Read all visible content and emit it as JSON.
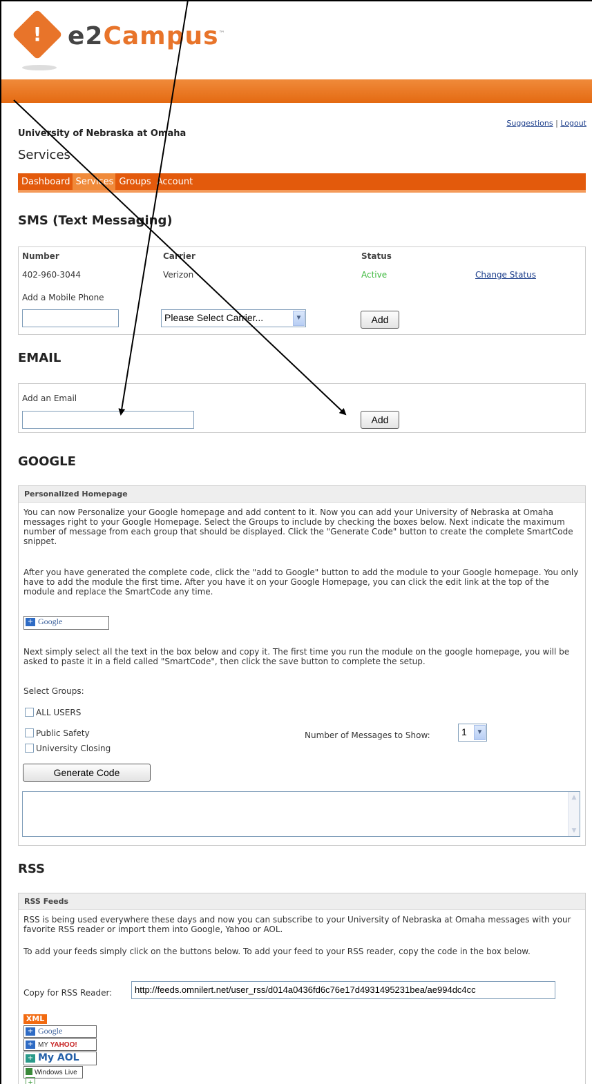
{
  "brand": {
    "e2": "e2",
    "campus": "Campus",
    "tm": "™"
  },
  "header": {
    "links": {
      "suggestions": "Suggestions",
      "separator": "|",
      "logout": "Logout"
    },
    "university": "University of Nebraska at Omaha",
    "page_title": "Services"
  },
  "nav": [
    "Dashboard",
    "Services",
    "Groups",
    "Account"
  ],
  "sms": {
    "heading": "SMS (Text Messaging)",
    "columns": {
      "number": "Number",
      "carrier": "Carrier",
      "status": "Status"
    },
    "row": {
      "number": "402-960-3044",
      "carrier": "Verizon",
      "status": "Active",
      "action": "Change Status"
    },
    "add_label": "Add a Mobile Phone",
    "carrier_select": "Please Select Carrier...",
    "add_button": "Add"
  },
  "email": {
    "heading": "EMAIL",
    "add_label": "Add an Email",
    "add_button": "Add"
  },
  "google": {
    "heading": "GOOGLE",
    "panel_title": "Personalized Homepage",
    "para1": "You can now Personalize your Google homepage and add content to it. Now you can add your University of Nebraska at Omaha messages right to your Google Homepage. Select the Groups to include by checking the boxes below. Next indicate the maximum number of message from each group that should be displayed. Click the \"Generate Code\" button to create the complete SmartCode snippet.",
    "para2": "After you have generated the complete code, click the \"add to Google\" button to add the module to your Google homepage. You only have to add the module the first time. After you have it on your Google Homepage, you can click the edit link at the top of the module and replace the SmartCode any time.",
    "add_google_label": "Google",
    "para3": "Next simply select all the text in the box below and copy it. The first time you run the module on the google homepage, you will be asked to paste it in a field called \"SmartCode\", then click the save button to complete the setup.",
    "select_groups": "Select Groups:",
    "groups": [
      "ALL USERS",
      "Public Safety",
      "University Closing"
    ],
    "num_messages_label": "Number of Messages to Show:",
    "num_messages_value": "1",
    "generate_button": "Generate Code"
  },
  "rss": {
    "heading": "RSS",
    "panel_title": "RSS Feeds",
    "para1": "RSS is being used everywhere these days and now you can subscribe to your University of Nebraska at Omaha messages with your favorite RSS reader or import them into Google, Yahoo or AOL.",
    "para2": "To add your feeds simply click on the buttons below. To add your feed to your RSS reader, copy the code in the box below.",
    "copy_label": "Copy for RSS Reader:",
    "feed_url": "http://feeds.omnilert.net/user_rss/d014a0436fd6c76e17d4931495231bea/ae994dc4cc",
    "xml": "XML",
    "google": "Google",
    "my": "MY",
    "yahoo": "YAHOO!",
    "aol": "My AOL",
    "windows_live": "Windows Live"
  }
}
